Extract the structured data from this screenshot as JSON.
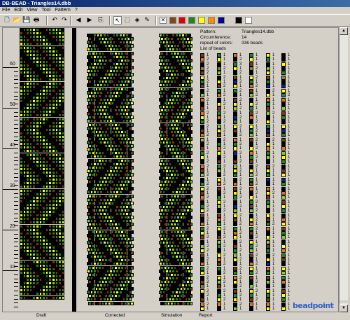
{
  "window": {
    "title": "DB-BEAD - Triangles14.dbb"
  },
  "menu": [
    "File",
    "Edit",
    "View",
    "Tool",
    "Pattern",
    "?"
  ],
  "toolbar": {
    "icons": [
      "new-file-icon",
      "open-icon",
      "save-icon",
      "print-icon",
      "undo-icon",
      "redo-icon",
      "arrow-left-icon",
      "arrow-right-icon",
      "preview-icon",
      "pointer-icon",
      "select-rect-icon",
      "fill-icon",
      "pipette-icon"
    ],
    "glyphs": [
      "🗋",
      "📂",
      "💾",
      "🖶",
      "↶",
      "↷",
      "◀",
      "▶",
      "⎘",
      "↖",
      "⬚",
      "◈",
      "✎"
    ],
    "palette": [
      "#ffffff",
      "#8b4513",
      "#e00000",
      "#1a8a1a",
      "#ffff00",
      "#ff8c00",
      "#000090",
      "#000000",
      "#ffffff"
    ]
  },
  "ruler": {
    "labels": [
      "60",
      "50",
      "40",
      "30",
      "20",
      "10"
    ]
  },
  "panels": {
    "draft": "Draft",
    "corrected": "Corrected",
    "simulation": "Simulation",
    "report": "Report"
  },
  "info": {
    "pattern_label": "Pattern:",
    "pattern_value": "Triangles14.dbb",
    "circ_label": "Circumference:",
    "circ_value": "14",
    "repeat_label": "repeat of colors:",
    "repeat_value": "336 beads",
    "list_label": "List of beads"
  },
  "colors": {
    "black": "#000000",
    "brown": "#7a3b10",
    "green": "#1e8c1e",
    "lime": "#8ccc30",
    "yellow": "#ffff00",
    "orange": "#e07818",
    "blue": "#1020a0",
    "olive": "#8a8a20"
  },
  "bead_list": {
    "col0": [
      [
        "brown",
        "1"
      ],
      [
        "orange",
        "2"
      ],
      [
        "black",
        "2"
      ],
      [
        "olive",
        "2"
      ],
      [
        "brown",
        "2"
      ],
      [
        "yellow",
        "1"
      ],
      [
        "green",
        "2"
      ],
      [
        "brown",
        "1"
      ],
      [
        "black",
        "2"
      ],
      [
        "lime",
        "1"
      ],
      [
        "orange",
        "2"
      ],
      [
        "black",
        "1"
      ],
      [
        "brown",
        "1"
      ],
      [
        "orange",
        "2"
      ],
      [
        "yellow",
        "1"
      ],
      [
        "green",
        "2"
      ],
      [
        "black",
        "2"
      ],
      [
        "brown",
        "1"
      ],
      [
        "orange",
        "2"
      ],
      [
        "lime",
        "1"
      ],
      [
        "black",
        "2"
      ],
      [
        "brown",
        "1"
      ],
      [
        "green",
        "2"
      ],
      [
        "yellow",
        "1"
      ],
      [
        "black",
        "2"
      ],
      [
        "orange",
        "2"
      ],
      [
        "brown",
        "1"
      ],
      [
        "lime",
        "2"
      ],
      [
        "black",
        "1"
      ],
      [
        "green",
        "2"
      ],
      [
        "yellow",
        "2"
      ],
      [
        "brown",
        "1"
      ],
      [
        "orange",
        "2"
      ],
      [
        "black",
        "1"
      ],
      [
        "green",
        "2"
      ],
      [
        "yellow",
        "2"
      ],
      [
        "brown",
        "1"
      ],
      [
        "black",
        "2"
      ],
      [
        "orange",
        "1"
      ],
      [
        "green",
        "2"
      ],
      [
        "yellow",
        "1"
      ],
      [
        "brown",
        "2"
      ],
      [
        "black",
        "1"
      ],
      [
        "lime",
        "2"
      ],
      [
        "yellow",
        "2"
      ],
      [
        "brown",
        "1"
      ],
      [
        "black",
        "2"
      ],
      [
        "orange",
        "1"
      ],
      [
        "green",
        "2"
      ],
      [
        "yellow",
        "1"
      ],
      [
        "black",
        "2"
      ],
      [
        "brown",
        "2"
      ],
      [
        "olive",
        "1"
      ],
      [
        "yellow",
        "2"
      ],
      [
        "black",
        "2"
      ],
      [
        "brown",
        "1"
      ],
      [
        "orange",
        "2"
      ],
      [
        "yellow",
        "1"
      ]
    ],
    "col1": [
      [
        "green",
        "1"
      ],
      [
        "yellow",
        "1"
      ],
      [
        "black",
        "1"
      ],
      [
        "olive",
        "2"
      ],
      [
        "lime",
        "1"
      ],
      [
        "black",
        "2"
      ],
      [
        "yellow",
        "1"
      ],
      [
        "brown",
        "2"
      ],
      [
        "green",
        "1"
      ],
      [
        "orange",
        "2"
      ],
      [
        "black",
        "1"
      ],
      [
        "yellow",
        "2"
      ],
      [
        "brown",
        "1"
      ],
      [
        "green",
        "2"
      ],
      [
        "orange",
        "1"
      ],
      [
        "black",
        "2"
      ],
      [
        "lime",
        "1"
      ],
      [
        "yellow",
        "2"
      ],
      [
        "brown",
        "1"
      ],
      [
        "black",
        "2"
      ],
      [
        "green",
        "1"
      ],
      [
        "orange",
        "2"
      ],
      [
        "yellow",
        "1"
      ],
      [
        "black",
        "2"
      ],
      [
        "brown",
        "1"
      ],
      [
        "green",
        "2"
      ],
      [
        "lime",
        "1"
      ],
      [
        "black",
        "2"
      ],
      [
        "yellow",
        "1"
      ],
      [
        "orange",
        "2"
      ],
      [
        "brown",
        "1"
      ],
      [
        "black",
        "2"
      ],
      [
        "green",
        "1"
      ],
      [
        "yellow",
        "2"
      ],
      [
        "lime",
        "1"
      ],
      [
        "black",
        "2"
      ],
      [
        "brown",
        "1"
      ],
      [
        "orange",
        "2"
      ],
      [
        "green",
        "1"
      ],
      [
        "yellow",
        "2"
      ],
      [
        "black",
        "1"
      ],
      [
        "brown",
        "2"
      ],
      [
        "lime",
        "1"
      ],
      [
        "green",
        "2"
      ],
      [
        "black",
        "1"
      ],
      [
        "yellow",
        "2"
      ],
      [
        "orange",
        "1"
      ],
      [
        "brown",
        "2"
      ],
      [
        "green",
        "1"
      ],
      [
        "black",
        "2"
      ],
      [
        "yellow",
        "1"
      ],
      [
        "lime",
        "2"
      ],
      [
        "brown",
        "1"
      ],
      [
        "black",
        "2"
      ],
      [
        "green",
        "1"
      ],
      [
        "yellow",
        "2"
      ],
      [
        "orange",
        "1"
      ],
      [
        "black",
        "1"
      ]
    ],
    "col2": [
      [
        "orange",
        "1"
      ],
      [
        "black",
        "2"
      ],
      [
        "green",
        "3"
      ],
      [
        "yellow",
        "1"
      ],
      [
        "black",
        "2"
      ],
      [
        "brown",
        "1"
      ],
      [
        "blue",
        "2"
      ],
      [
        "yellow",
        "1"
      ],
      [
        "green",
        "2"
      ],
      [
        "black",
        "1"
      ],
      [
        "brown",
        "2"
      ],
      [
        "yellow",
        "1"
      ],
      [
        "lime",
        "2"
      ],
      [
        "black",
        "1"
      ],
      [
        "blue",
        "2"
      ],
      [
        "green",
        "1"
      ],
      [
        "yellow",
        "2"
      ],
      [
        "brown",
        "1"
      ],
      [
        "black",
        "2"
      ],
      [
        "orange",
        "1"
      ],
      [
        "green",
        "2"
      ],
      [
        "yellow",
        "1"
      ],
      [
        "blue",
        "2"
      ],
      [
        "black",
        "1"
      ],
      [
        "brown",
        "2"
      ],
      [
        "lime",
        "1"
      ],
      [
        "yellow",
        "2"
      ],
      [
        "green",
        "1"
      ],
      [
        "black",
        "2"
      ],
      [
        "orange",
        "1"
      ],
      [
        "brown",
        "2"
      ],
      [
        "yellow",
        "1"
      ],
      [
        "green",
        "2"
      ],
      [
        "black",
        "1"
      ],
      [
        "blue",
        "2"
      ],
      [
        "lime",
        "1"
      ],
      [
        "yellow",
        "2"
      ],
      [
        "brown",
        "1"
      ],
      [
        "black",
        "2"
      ],
      [
        "green",
        "1"
      ],
      [
        "orange",
        "2"
      ],
      [
        "yellow",
        "1"
      ],
      [
        "black",
        "2"
      ],
      [
        "brown",
        "1"
      ],
      [
        "green",
        "2"
      ],
      [
        "lime",
        "1"
      ],
      [
        "yellow",
        "2"
      ],
      [
        "black",
        "1"
      ],
      [
        "brown",
        "2"
      ],
      [
        "green",
        "1"
      ],
      [
        "orange",
        "2"
      ],
      [
        "yellow",
        "1"
      ],
      [
        "black",
        "2"
      ],
      [
        "brown",
        "1"
      ],
      [
        "green",
        "2"
      ],
      [
        "yellow",
        "1"
      ],
      [
        "black",
        "2"
      ],
      [
        "lime",
        "1"
      ]
    ],
    "col3": [
      [
        "green",
        "1"
      ],
      [
        "yellow",
        "1"
      ],
      [
        "brown",
        "1"
      ],
      [
        "olive",
        "2"
      ],
      [
        "black",
        "1"
      ],
      [
        "yellow",
        "2"
      ],
      [
        "green",
        "1"
      ],
      [
        "orange",
        "2"
      ],
      [
        "brown",
        "1"
      ],
      [
        "lime",
        "2"
      ],
      [
        "black",
        "1"
      ],
      [
        "yellow",
        "2"
      ],
      [
        "green",
        "1"
      ],
      [
        "brown",
        "2"
      ],
      [
        "orange",
        "1"
      ],
      [
        "black",
        "2"
      ],
      [
        "yellow",
        "1"
      ],
      [
        "green",
        "2"
      ],
      [
        "lime",
        "1"
      ],
      [
        "brown",
        "2"
      ],
      [
        "black",
        "1"
      ],
      [
        "yellow",
        "2"
      ],
      [
        "orange",
        "1"
      ],
      [
        "green",
        "2"
      ],
      [
        "brown",
        "1"
      ],
      [
        "black",
        "2"
      ],
      [
        "yellow",
        "1"
      ],
      [
        "lime",
        "2"
      ],
      [
        "green",
        "1"
      ],
      [
        "brown",
        "2"
      ],
      [
        "orange",
        "1"
      ],
      [
        "black",
        "2"
      ],
      [
        "yellow",
        "1"
      ],
      [
        "green",
        "2"
      ],
      [
        "brown",
        "1"
      ],
      [
        "lime",
        "2"
      ],
      [
        "black",
        "1"
      ],
      [
        "yellow",
        "2"
      ],
      [
        "orange",
        "1"
      ],
      [
        "green",
        "2"
      ],
      [
        "brown",
        "1"
      ],
      [
        "black",
        "2"
      ],
      [
        "yellow",
        "1"
      ],
      [
        "green",
        "2"
      ],
      [
        "lime",
        "1"
      ],
      [
        "brown",
        "2"
      ],
      [
        "black",
        "1"
      ],
      [
        "orange",
        "2"
      ],
      [
        "yellow",
        "1"
      ],
      [
        "green",
        "2"
      ],
      [
        "brown",
        "1"
      ],
      [
        "black",
        "2"
      ],
      [
        "lime",
        "1"
      ],
      [
        "yellow",
        "2"
      ],
      [
        "green",
        "1"
      ],
      [
        "brown",
        "2"
      ],
      [
        "orange",
        "1"
      ],
      [
        "black",
        "1"
      ]
    ],
    "col4": [
      [
        "yellow",
        "1"
      ],
      [
        "green",
        "1"
      ],
      [
        "black",
        "1"
      ],
      [
        "lime",
        "1"
      ],
      [
        "yellow",
        "1"
      ],
      [
        "brown",
        "1"
      ],
      [
        "green",
        "1"
      ],
      [
        "blue",
        "1"
      ],
      [
        "black",
        "2"
      ],
      [
        "yellow",
        "1"
      ],
      [
        "orange",
        "1"
      ],
      [
        "green",
        "1"
      ],
      [
        "brown",
        "1"
      ],
      [
        "lime",
        "2"
      ],
      [
        "black",
        "1"
      ],
      [
        "yellow",
        "1"
      ],
      [
        "green",
        "1"
      ],
      [
        "blue",
        "1"
      ],
      [
        "brown",
        "1"
      ],
      [
        "black",
        "2"
      ],
      [
        "yellow",
        "1"
      ],
      [
        "orange",
        "1"
      ],
      [
        "green",
        "1"
      ],
      [
        "lime",
        "1"
      ],
      [
        "black",
        "1"
      ],
      [
        "brown",
        "2"
      ],
      [
        "yellow",
        "1"
      ],
      [
        "green",
        "1"
      ],
      [
        "blue",
        "1"
      ],
      [
        "black",
        "1"
      ],
      [
        "orange",
        "1"
      ],
      [
        "yellow",
        "2"
      ],
      [
        "brown",
        "1"
      ],
      [
        "green",
        "1"
      ],
      [
        "lime",
        "1"
      ],
      [
        "black",
        "1"
      ],
      [
        "yellow",
        "1"
      ],
      [
        "brown",
        "1"
      ],
      [
        "green",
        "2"
      ],
      [
        "orange",
        "1"
      ],
      [
        "black",
        "1"
      ],
      [
        "yellow",
        "1"
      ],
      [
        "lime",
        "1"
      ],
      [
        "brown",
        "1"
      ],
      [
        "green",
        "1"
      ],
      [
        "black",
        "2"
      ],
      [
        "yellow",
        "1"
      ],
      [
        "blue",
        "1"
      ],
      [
        "orange",
        "1"
      ],
      [
        "green",
        "1"
      ],
      [
        "brown",
        "1"
      ],
      [
        "lime",
        "1"
      ],
      [
        "black",
        "1"
      ],
      [
        "yellow",
        "1"
      ],
      [
        "green",
        "1"
      ],
      [
        "brown",
        "1"
      ],
      [
        "orange",
        "1"
      ],
      [
        "yellow",
        "1"
      ]
    ],
    "col5": [
      [
        "black",
        "1"
      ],
      [
        "black",
        "1"
      ],
      [
        "yellow",
        "1"
      ],
      [
        "black",
        "1"
      ],
      [
        "green",
        "1"
      ],
      [
        "olive",
        "1"
      ],
      [
        "black",
        "1"
      ],
      [
        "blue",
        "1"
      ],
      [
        "yellow",
        "1"
      ],
      [
        "green",
        "2"
      ],
      [
        "orange",
        "1"
      ],
      [
        "black",
        "1"
      ],
      [
        "lime",
        "1"
      ],
      [
        "brown",
        "1"
      ],
      [
        "green",
        "1"
      ],
      [
        "black",
        "1"
      ],
      [
        "yellow",
        "1"
      ],
      [
        "blue",
        "1"
      ],
      [
        "green",
        "1"
      ],
      [
        "brown",
        "1"
      ],
      [
        "black",
        "1"
      ],
      [
        "orange",
        "1"
      ],
      [
        "lime",
        "1"
      ],
      [
        "yellow",
        "1"
      ],
      [
        "green",
        "1"
      ],
      [
        "black",
        "1"
      ],
      [
        "brown",
        "1"
      ],
      [
        "yellow",
        "1"
      ],
      [
        "blue",
        "1"
      ],
      [
        "green",
        "1"
      ],
      [
        "black",
        "1"
      ],
      [
        "orange",
        "1"
      ],
      [
        "lime",
        "1"
      ],
      [
        "brown",
        "1"
      ],
      [
        "yellow",
        "1"
      ],
      [
        "green",
        "1"
      ],
      [
        "black",
        "1"
      ],
      [
        "orange",
        "1"
      ],
      [
        "yellow",
        "1"
      ],
      [
        "brown",
        "1"
      ],
      [
        "green",
        "1"
      ],
      [
        "lime",
        "1"
      ],
      [
        "black",
        "1"
      ],
      [
        "yellow",
        "1"
      ],
      [
        "orange",
        "1"
      ],
      [
        "green",
        "1"
      ],
      [
        "brown",
        "1"
      ],
      [
        "black",
        "1"
      ],
      [
        "yellow",
        "1"
      ],
      [
        "lime",
        "1"
      ],
      [
        "green",
        "1"
      ],
      [
        "orange",
        "1"
      ],
      [
        "black",
        "1"
      ],
      [
        "brown",
        "1"
      ],
      [
        "yellow",
        "1"
      ],
      [
        "green",
        "1"
      ],
      [
        "black",
        "1"
      ],
      [
        "yellow",
        "1"
      ]
    ]
  }
}
